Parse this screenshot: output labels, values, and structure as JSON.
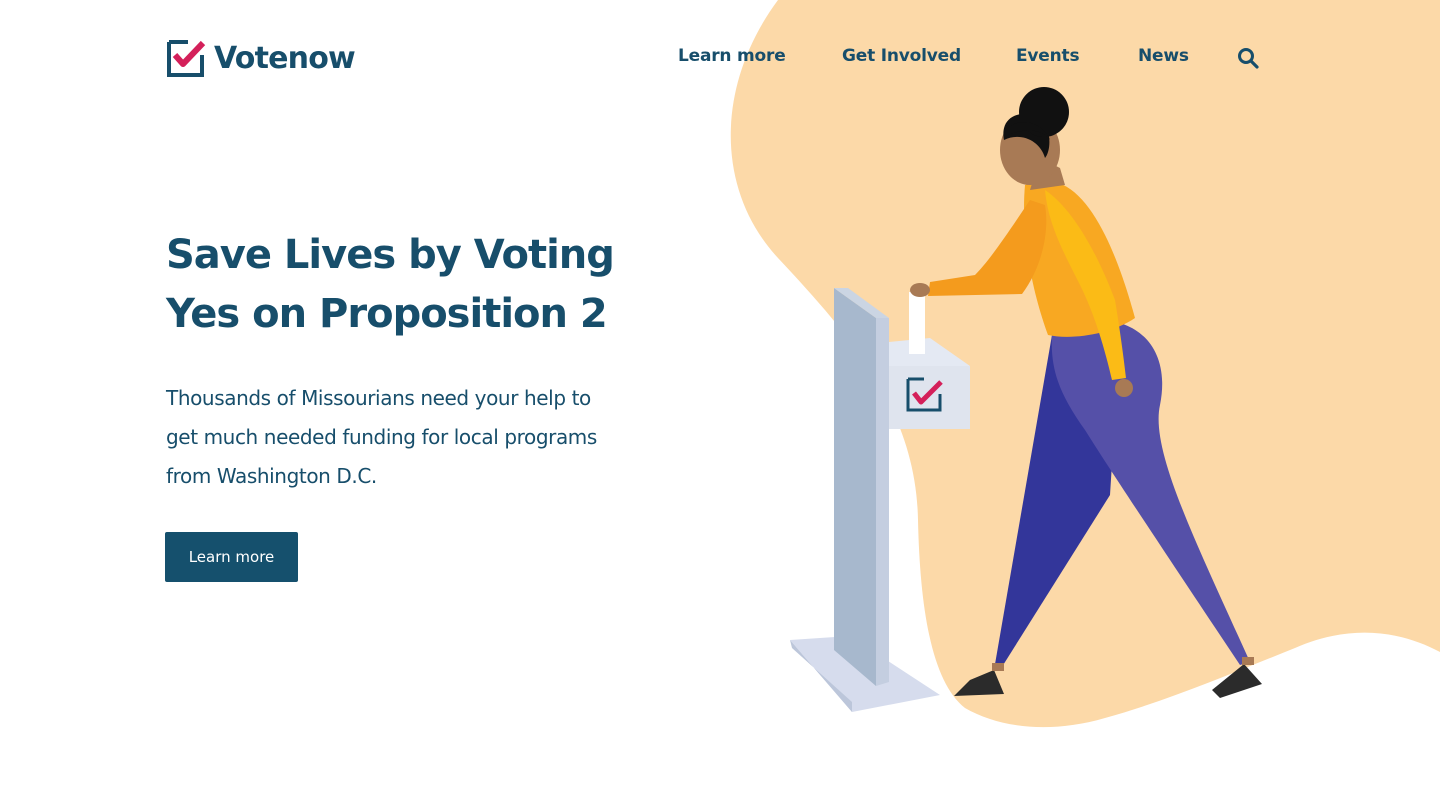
{
  "brand": {
    "name": "Votenow",
    "logo_icon": "ballot-checkbox-icon"
  },
  "nav": {
    "items": [
      {
        "label": "Learn more"
      },
      {
        "label": "Get Involved"
      },
      {
        "label": "Events"
      },
      {
        "label": "News"
      }
    ],
    "search_icon": "search-icon"
  },
  "hero": {
    "title": "Save Lives by Voting Yes on Proposition 2",
    "body": "Thousands of Missourians need your help to get much needed funding for local programs from Washington D.C.",
    "cta_label": "Learn more"
  },
  "colors": {
    "primary": "#174e6b",
    "accent": "#d4205a",
    "blob": "#fcd9a8",
    "button": "#15506d"
  }
}
